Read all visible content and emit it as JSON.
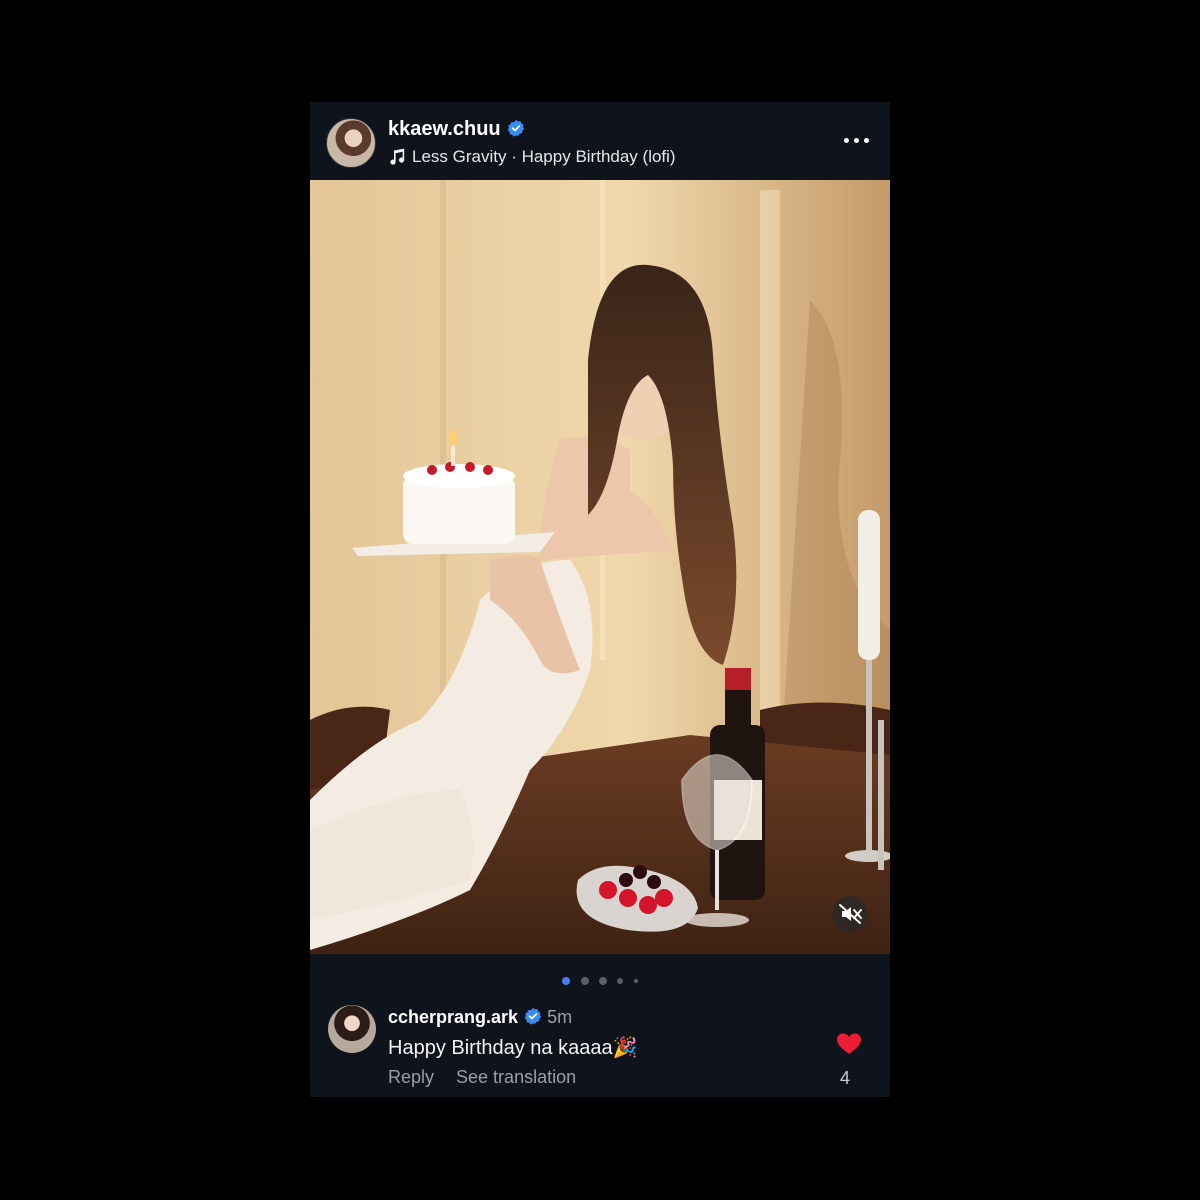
{
  "post": {
    "username": "kkaew.chuu",
    "verified": true,
    "music": "Less Gravity · Happy Birthday (lofi)",
    "more_icon": "more-horizontal-icon",
    "carousel": {
      "count": 5,
      "active_index": 0
    },
    "mute_icon": "muted-speaker-icon"
  },
  "comment": {
    "username": "ccherprang.ark",
    "verified": true,
    "time": "5m",
    "text": "Happy Birthday na kaaaa🎉",
    "reply_label": "Reply",
    "translate_label": "See translation",
    "like_count": "4",
    "liked": true
  },
  "colors": {
    "background": "#000000",
    "card": "#0f131b",
    "verified": "#3b8cf0",
    "heart": "#ee1d36",
    "active_dot": "#4a7dfc"
  }
}
